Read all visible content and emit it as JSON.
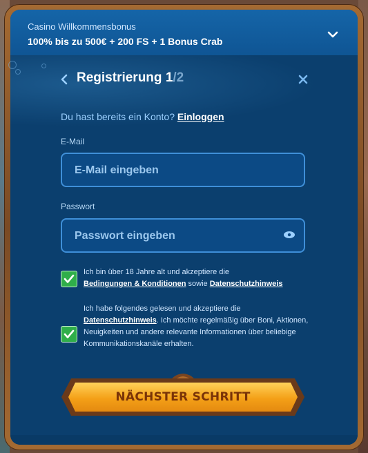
{
  "bonus": {
    "title": "Casino Willkommensbonus",
    "description": "100% bis zu 500€ + 200 FS + 1 Bonus Crab"
  },
  "registration": {
    "title": "Registrierung",
    "step_current": "1",
    "step_total": "/2"
  },
  "login": {
    "prompt": "Du hast bereits ein Konto?",
    "link": "Einloggen"
  },
  "email": {
    "label": "E-Mail",
    "placeholder": "E-Mail eingeben",
    "value": ""
  },
  "password": {
    "label": "Passwort",
    "placeholder": "Passwort eingeben",
    "value": ""
  },
  "consent_age": {
    "checked": true,
    "text_before": "Ich bin über 18 Jahre alt und akzeptiere die",
    "link_terms": "Bedingungen & Konditionen",
    "text_mid": "sowie",
    "link_privacy": "Datenschutzhinweis"
  },
  "consent_marketing": {
    "checked": true,
    "text_before": "Ich habe folgendes gelesen und akzeptiere die",
    "link_privacy": "Datenschutzhinweis",
    "text_after": ". Ich möchte regelmäßig über Boni, Aktionen, Neuigkeiten und andere relevante Informationen über beliebige Kommunikationskanäle erhalten."
  },
  "next_button": {
    "label": "NÄCHSTER SCHRITT"
  },
  "colors": {
    "panel": "#0b3f6e",
    "bonus_bar": "#1565a8",
    "field_border": "#3f8fd8",
    "checkbox": "#2fae4a",
    "button": "#f4a017"
  },
  "icons": {
    "bonus_toggle": "chevron-down-icon",
    "back": "chevron-left-icon",
    "close": "close-icon",
    "password_visibility": "eye-icon",
    "checkbox": "check-icon"
  }
}
